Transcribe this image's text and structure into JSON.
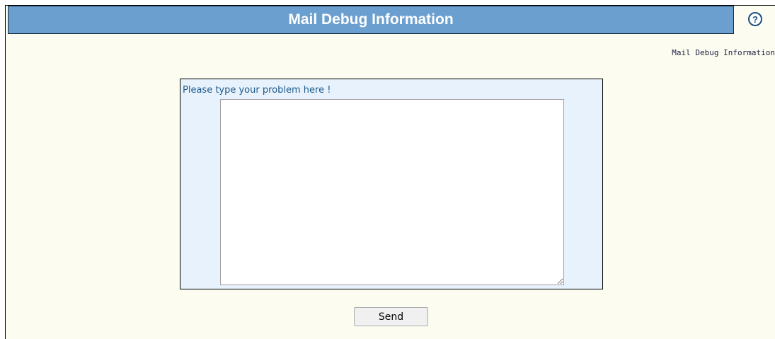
{
  "header": {
    "title": "Mail Debug Information",
    "help_icon": "question-circle-icon",
    "help_glyph": "?"
  },
  "breadcrumb": {
    "text": "Mail Debug Information"
  },
  "form": {
    "prompt_label": "Please type your problem here !",
    "textarea_value": "",
    "send_label": "Send"
  },
  "colors": {
    "title_bar": "#6a9fd0",
    "page_background": "#fcfcf0",
    "form_background": "#e8f2fc",
    "prompt_text": "#1d5a8c"
  }
}
